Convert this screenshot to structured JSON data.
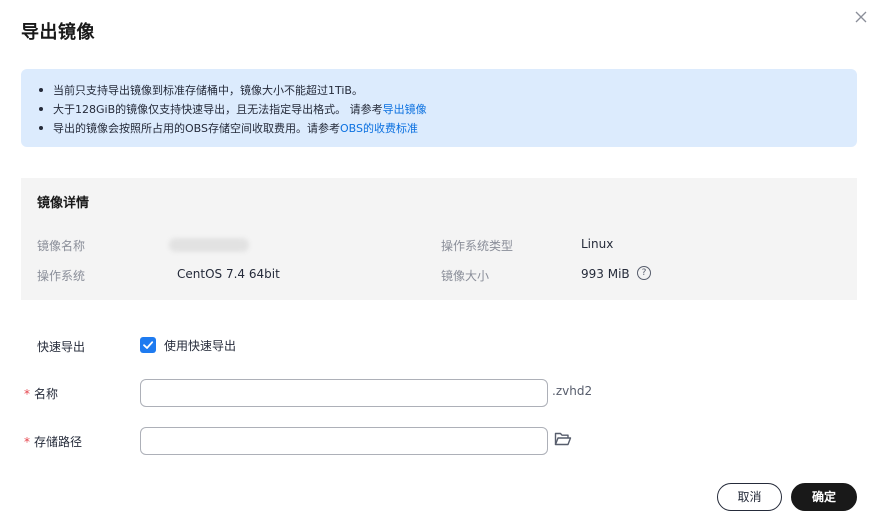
{
  "dialog": {
    "title": "导出镜像",
    "close_icon": "close-icon"
  },
  "notice": {
    "items": [
      {
        "text": "当前只支持导出镜像到标准存储桶中，镜像大小不能超过1TiB。",
        "link": ""
      },
      {
        "text": "大于128GiB的镜像仅支持快速导出，且无法指定导出格式。 请参考",
        "link": "导出镜像"
      },
      {
        "text": "导出的镜像会按照所占用的OBS存储空间收取费用。请参考",
        "link": "OBS的收费标准"
      }
    ],
    "link_color": "#0c71e0",
    "background": "#dcebfd"
  },
  "details": {
    "title": "镜像详情",
    "name_label": "镜像名称",
    "os_type_label": "操作系统类型",
    "os_type_value": "Linux",
    "os_label": "操作系统",
    "os_value": "CentOS 7.4 64bit",
    "size_label": "镜像大小",
    "size_value": "993 MiB",
    "help_icon": "?"
  },
  "form": {
    "fast_export_label": "快速导出",
    "fast_export_checkbox_label": "使用快速导出",
    "fast_export_checked": true,
    "name_label": "名称",
    "name_value": "",
    "name_suffix": ".zvhd2",
    "path_label": "存储路径",
    "path_value": "",
    "required_mark": "*",
    "folder_icon": "folder-open-icon"
  },
  "footer": {
    "cancel_label": "取消",
    "ok_label": "确定"
  },
  "colors": {
    "accent": "#1e7bf0",
    "primary_button": "#191919",
    "required": "#e6454d"
  }
}
